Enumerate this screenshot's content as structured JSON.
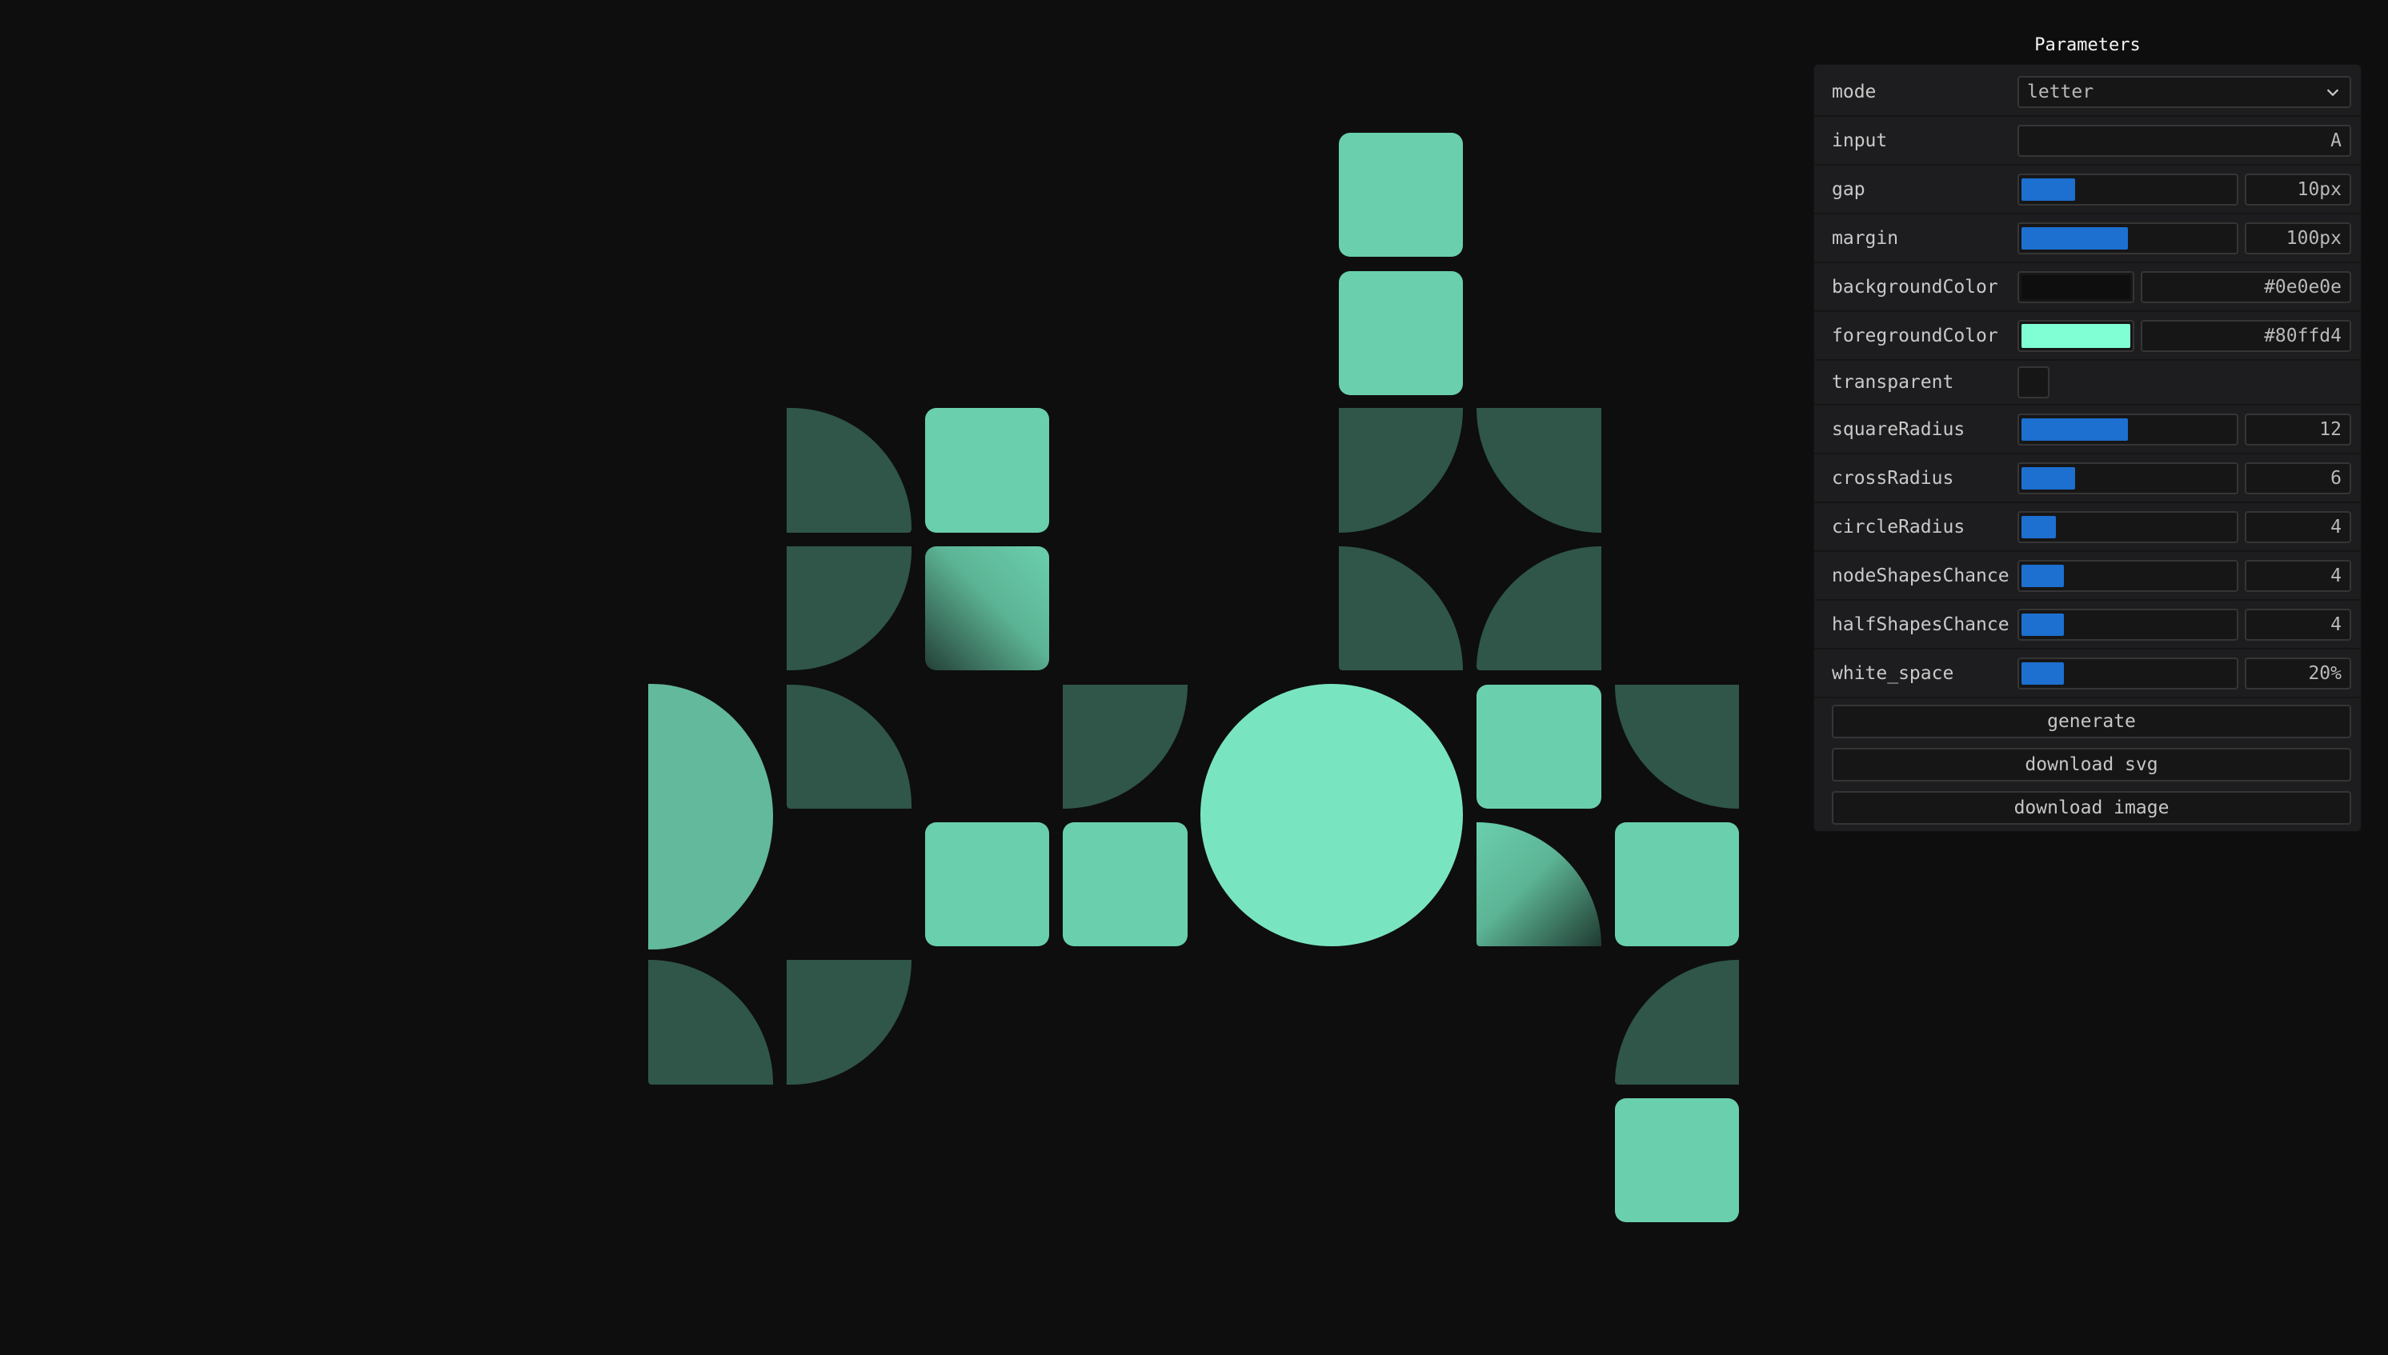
{
  "colors": {
    "background": "#0e0e0e",
    "tile_light": "#6acfad",
    "tile_dark": "#2f5648",
    "circle": "#79e5c0",
    "half_circle": "#63b99b",
    "slider_fill": "#1d6fd0"
  },
  "panel": {
    "title": "Parameters",
    "mode": {
      "label": "mode",
      "value": "letter",
      "icon": "chevron-down-icon"
    },
    "input": {
      "label": "input",
      "value": "A"
    },
    "gap": {
      "label": "gap",
      "value": "10px",
      "level": 0.25
    },
    "margin": {
      "label": "margin",
      "value": "100px",
      "level": 0.5
    },
    "backgroundColor": {
      "label": "backgroundColor",
      "value": "#0e0e0e",
      "swatch": "#0e0e0e"
    },
    "foregroundColor": {
      "label": "foregroundColor",
      "value": "#80ffd4",
      "swatch": "#80ffd4"
    },
    "transparent": {
      "label": "transparent",
      "checked": false
    },
    "squareRadius": {
      "label": "squareRadius",
      "value": "12",
      "level": 0.5
    },
    "crossRadius": {
      "label": "crossRadius",
      "value": "6",
      "level": 0.25
    },
    "circleRadius": {
      "label": "circleRadius",
      "value": "4",
      "level": 0.16
    },
    "nodeShapesChance": {
      "label": "nodeShapesChance",
      "value": "4",
      "level": 0.2
    },
    "halfShapesChance": {
      "label": "halfShapesChance",
      "value": "4",
      "level": 0.2
    },
    "white_space": {
      "label": "white_space",
      "value": "20%",
      "level": 0.2
    },
    "buttons": {
      "generate": "generate",
      "download_svg": "download svg",
      "download_image": "download image"
    }
  }
}
